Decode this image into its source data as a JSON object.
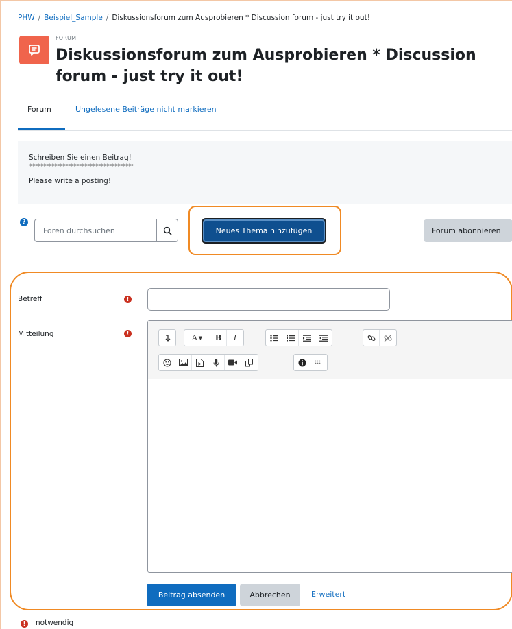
{
  "breadcrumb": {
    "items": [
      "PHW",
      "Beispiel_Sample",
      "Diskussionsforum zum Ausprobieren * Discussion forum - just try it out!"
    ],
    "separator": "/"
  },
  "header": {
    "kicker": "FORUM",
    "title": "Diskussionsforum zum Ausprobieren * Discussion forum - just try it out!",
    "icon": "forum-speech-bubble-icon"
  },
  "tabs": [
    {
      "label": "Forum",
      "active": true
    },
    {
      "label": "Ungelesene Beiträge nicht markieren",
      "active": false
    }
  ],
  "intro": {
    "line1": "Schreiben Sie einen Beitrag!",
    "divider": "**************************************",
    "line2": "Please write a posting!"
  },
  "search": {
    "placeholder": "Foren durchsuchen",
    "help_icon": "question-circle-icon",
    "button_icon": "search-icon"
  },
  "actions": {
    "new_topic": "Neues Thema hinzufügen",
    "subscribe": "Forum abonnieren"
  },
  "form": {
    "subject_label": "Betreff",
    "subject_value": "",
    "message_label": "Mitteilung",
    "required_icon": "exclamation-circle-icon",
    "submit": "Beitrag absenden",
    "cancel": "Abbrechen",
    "advanced": "Erweitert",
    "required_note": "notwendig"
  },
  "editor": {
    "row1": [
      [
        "collapse-icon"
      ],
      [
        "font-style-icon",
        "bold-icon",
        "italic-icon"
      ],
      [
        "unordered-list-icon",
        "ordered-list-icon",
        "indent-icon",
        "outdent-icon"
      ],
      [
        "link-icon",
        "unlink-icon"
      ]
    ],
    "row2": [
      [
        "emoji-icon",
        "image-icon",
        "media-icon",
        "record-audio-icon",
        "record-video-icon",
        "manage-files-icon"
      ],
      [
        "accessibility-checker-icon",
        "screenreader-helper-icon"
      ]
    ],
    "font_button_label": "A",
    "bold_label": "B",
    "italic_label": "I"
  },
  "colors": {
    "link": "#0f6cbf",
    "primary_button": "#0f6cbf",
    "highlight_outline": "#f08a24",
    "forum_icon_bg": "#f0644c",
    "required": "#ca3120"
  }
}
